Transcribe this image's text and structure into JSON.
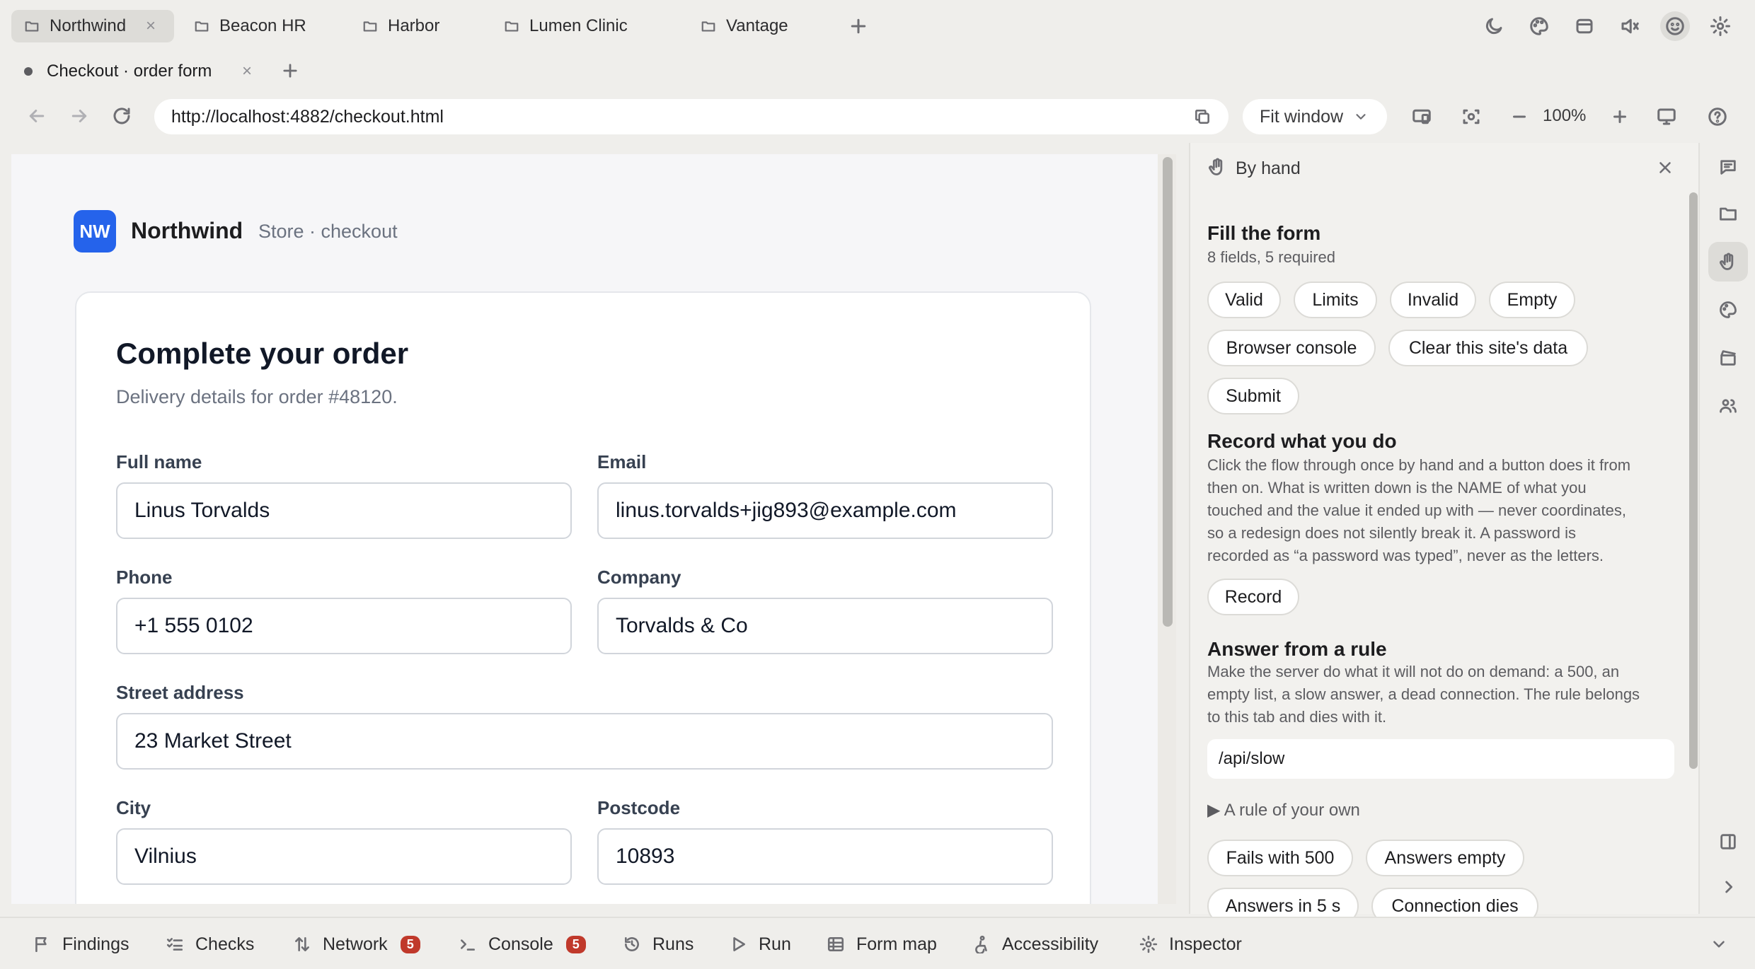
{
  "workspace_tabs": [
    {
      "label": "Northwind",
      "active": true
    },
    {
      "label": "Beacon HR"
    },
    {
      "label": "Harbor"
    },
    {
      "label": "Lumen Clinic"
    },
    {
      "label": "Vantage"
    }
  ],
  "top_icons": [
    "moon-icon",
    "palette-icon",
    "storage-icon",
    "mute-icon",
    "smiley-icon",
    "gear-icon"
  ],
  "page_tab": {
    "label": "Checkout · order form"
  },
  "address": {
    "url": "http://localhost:4882/checkout.html",
    "fit_mode": "Fit window",
    "zoom": "100%"
  },
  "page": {
    "brand_logo": "NW",
    "brand_name": "Northwind",
    "brand_sub": "Store · checkout",
    "title": "Complete your order",
    "subtitle": "Delivery details for order #48120.",
    "fields": {
      "full_name": {
        "label": "Full name",
        "value": "Linus Torvalds"
      },
      "email": {
        "label": "Email",
        "value": "linus.torvalds+jig893@example.com"
      },
      "phone": {
        "label": "Phone",
        "value": "+1 555 0102"
      },
      "company": {
        "label": "Company",
        "value": "Torvalds & Co"
      },
      "street": {
        "label": "Street address",
        "value": "23 Market Street"
      },
      "city": {
        "label": "City",
        "value": "Vilnius"
      },
      "postcode": {
        "label": "Postcode",
        "value": "10893"
      }
    }
  },
  "panel": {
    "header": "By hand",
    "fill": {
      "title": "Fill the form",
      "meta": "8 fields, 5 required",
      "buttons": [
        "Valid",
        "Limits",
        "Invalid",
        "Empty",
        "Browser console",
        "Clear this site's data",
        "Submit"
      ]
    },
    "record": {
      "title": "Record what you do",
      "lines": [
        "Click the flow through once by hand and a button does it from",
        "then on. What is written down is the NAME of what you",
        "touched and the value it ended up with — never coordinates,",
        "so a redesign does not silently break it. A password is",
        "recorded as “a password was typed”, never as the letters."
      ],
      "button": "Record"
    },
    "rule": {
      "title": "Answer from a rule",
      "lines": [
        "Make the server do what it will not do on demand: a 500, an",
        "empty list, a slow answer, a dead connection. The rule belongs",
        "to this tab and dies with it."
      ],
      "input_value": "/api/slow",
      "own_rule": "▶ A rule of your own",
      "buttons": [
        "Fails with 500",
        "Answers empty",
        "Answers in 5 s",
        "Connection dies"
      ]
    }
  },
  "bottom_tabs": [
    {
      "label": "Findings",
      "icon": "flag-icon"
    },
    {
      "label": "Checks",
      "icon": "checklist-icon"
    },
    {
      "label": "Network",
      "icon": "arrows-icon",
      "badge": "5"
    },
    {
      "label": "Console",
      "icon": "terminal-icon",
      "badge": "5"
    },
    {
      "label": "Runs",
      "icon": "history-icon"
    },
    {
      "label": "Run",
      "icon": "play-icon"
    },
    {
      "label": "Form map",
      "icon": "table-icon"
    },
    {
      "label": "Accessibility",
      "icon": "accessibility-icon"
    },
    {
      "label": "Inspector",
      "icon": "inspector-icon"
    }
  ]
}
